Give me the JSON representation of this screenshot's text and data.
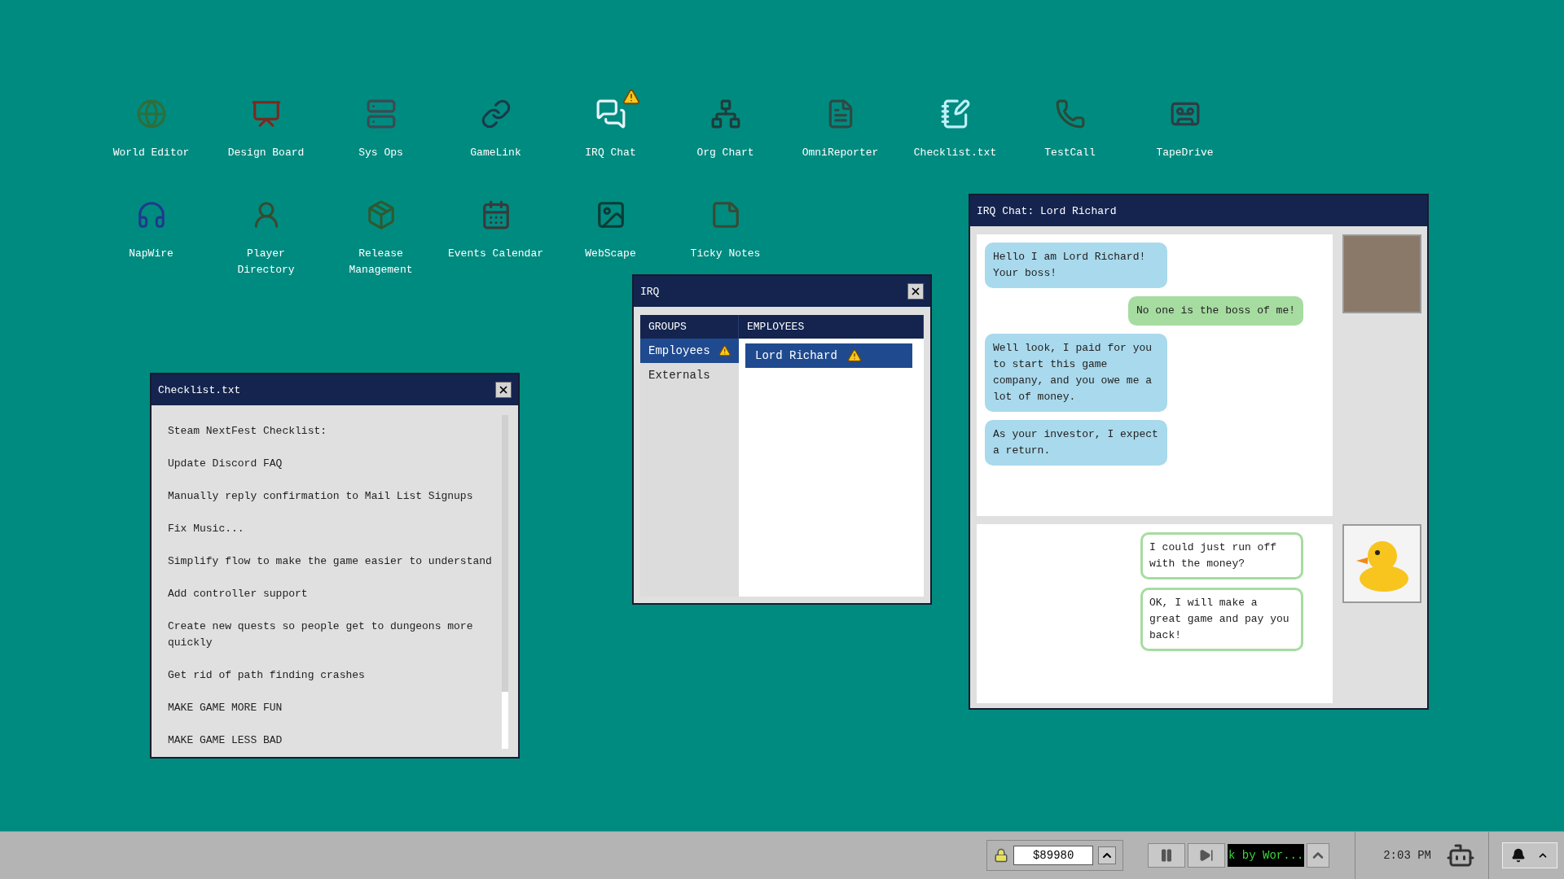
{
  "desktop_icons": [
    {
      "label": "World Editor",
      "alert": false
    },
    {
      "label": "Design Board",
      "alert": false
    },
    {
      "label": "Sys Ops",
      "alert": false
    },
    {
      "label": "GameLink",
      "alert": false
    },
    {
      "label": "IRQ Chat",
      "alert": true
    },
    {
      "label": "Org Chart",
      "alert": false
    },
    {
      "label": "OmniReporter",
      "alert": false
    },
    {
      "label": "Checklist.txt",
      "alert": false
    },
    {
      "label": "TestCall",
      "alert": false
    },
    {
      "label": "TapeDrive",
      "alert": false
    },
    {
      "label": "NapWire",
      "alert": false
    },
    {
      "label": "Player Directory",
      "alert": false
    },
    {
      "label": "Release Management",
      "alert": false
    },
    {
      "label": "Events Calendar",
      "alert": false
    },
    {
      "label": "WebScape",
      "alert": false
    },
    {
      "label": "Ticky Notes",
      "alert": false
    }
  ],
  "checklist_window": {
    "title": "Checklist.txt",
    "items": [
      "Steam NextFest Checklist:",
      "Update Discord FAQ",
      "Manually reply confirmation to Mail List Signups",
      "Fix Music...",
      "Simplify flow to make the game easier to understand",
      "Add controller support",
      "Create new quests so people get to dungeons more quickly",
      "Get rid of path finding crashes",
      "MAKE GAME MORE FUN",
      "MAKE GAME LESS BAD"
    ]
  },
  "irq_window": {
    "title": "IRQ",
    "groups_header": "GROUPS",
    "employees_header": "EMPLOYEES",
    "groups": [
      {
        "label": "Employees",
        "selected": true,
        "alert": true
      },
      {
        "label": "Externals",
        "selected": false,
        "alert": false
      }
    ],
    "employees": [
      {
        "label": "Lord Richard",
        "selected": true,
        "alert": true
      }
    ]
  },
  "chat_window": {
    "title": "IRQ Chat: Lord Richard",
    "messages": [
      {
        "kind": "received",
        "text": "Hello I am Lord Richard! Your boss!"
      },
      {
        "kind": "sent",
        "text": "No one is the boss of me!"
      },
      {
        "kind": "received",
        "text": "Well look, I paid for you to start this game company, and you owe me a lot of money."
      },
      {
        "kind": "received",
        "text": "As your investor, I expect a return."
      }
    ],
    "replies": [
      "I could just run off with the money?",
      "OK, I will make a great game and pay you back!"
    ]
  },
  "taskbar": {
    "money": "$89980",
    "track": "k by Wor...",
    "time": "2:03 PM"
  }
}
